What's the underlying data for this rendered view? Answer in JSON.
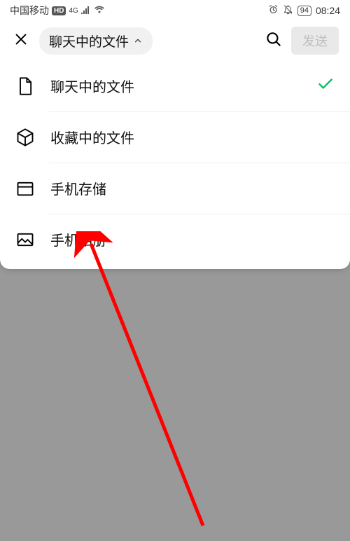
{
  "status": {
    "carrier": "中国移动",
    "hd_badge": "HD",
    "network": "4G",
    "battery": "94",
    "time": "08:24"
  },
  "header": {
    "dropdown_label": "聊天中的文件",
    "send_label": "发送"
  },
  "menu": {
    "items": [
      {
        "icon": "document-icon",
        "label": "聊天中的文件",
        "selected": true
      },
      {
        "icon": "cube-icon",
        "label": "收藏中的文件",
        "selected": false
      },
      {
        "icon": "folder-icon",
        "label": "手机存储",
        "selected": false
      },
      {
        "icon": "image-icon",
        "label": "手机相册",
        "selected": false
      }
    ]
  },
  "annotation": {
    "arrow_color": "#ff0000"
  }
}
